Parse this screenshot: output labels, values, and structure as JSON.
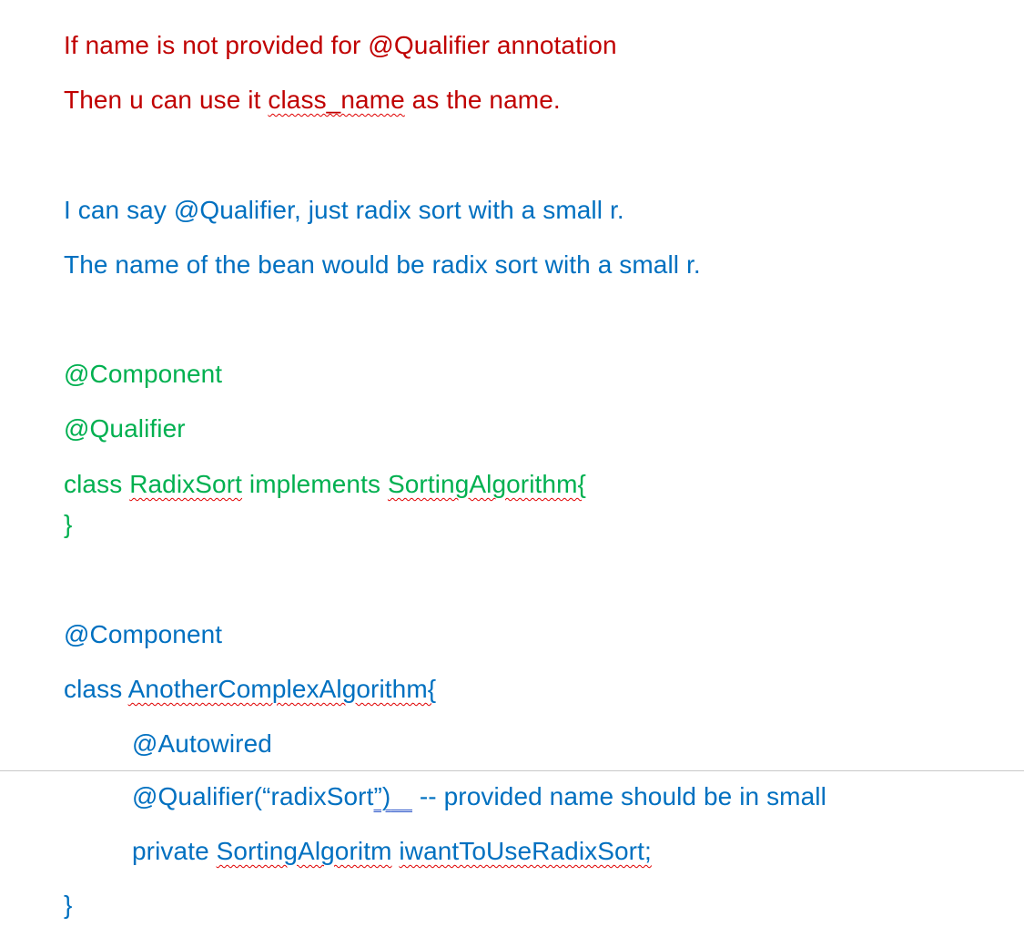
{
  "doc": {
    "l1": "If name is not provided for @Qualifier annotation",
    "l2a": "Then u can use it ",
    "l2b": "class_name",
    "l2c": " as the name.",
    "l3": "I can say @Qualifier, just radix sort with a small r.",
    "l4": "The name of the bean would be radix sort with a small r.",
    "l5": "@Component",
    "l6": "@Qualifier",
    "l7a": "class ",
    "l7b": "RadixSort",
    "l7c": " implements ",
    "l7d": "SortingAlgorithm{",
    "l8": "}",
    "l9": "@Component",
    "l10a": "class ",
    "l10b": "AnotherComplexAlgorithm{",
    "l11": "@Autowired",
    "l12a": "@Qualifier(“radixSort",
    "l12b": "”)",
    "l12c": "   ",
    "l12d": " -- provided name should be in small",
    "l13a": "private ",
    "l13b": "SortingAlgoritm",
    "l13c": " ",
    "l13d": "iwantToUseRadixSort;",
    "l14": "}"
  },
  "colors": {
    "red": "#c00000",
    "blue": "#0070c0",
    "green": "#00b050",
    "spell_squiggle": "#e00000",
    "grammar_underline": "#2a55c8"
  }
}
